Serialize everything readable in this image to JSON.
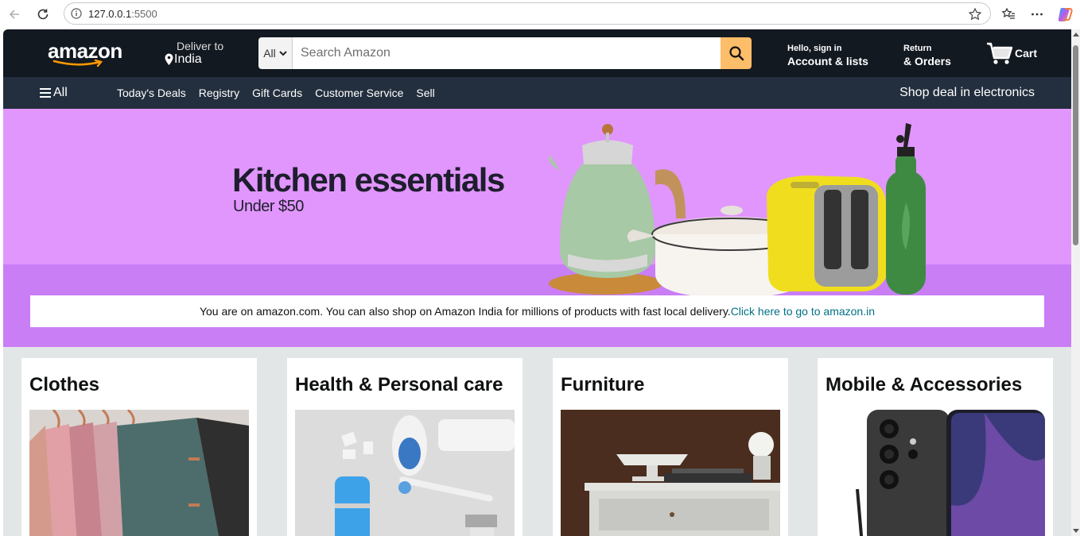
{
  "browser": {
    "url_host": "127.0.0.1",
    "url_port": ":5500"
  },
  "header": {
    "logo_text": "amazon",
    "deliver_line1": "Deliver to",
    "deliver_line2": "India",
    "search_category": "All",
    "search_placeholder": "Search Amazon",
    "account_line1": "Hello, sign in",
    "account_line2": "Account & lists",
    "returns_line1": "Return",
    "returns_line2": "& Orders",
    "cart_label": "Cart"
  },
  "subnav": {
    "all_label": "All",
    "links": [
      "Today's Deals",
      "Registry",
      "Gift Cards",
      "Customer Service",
      "Sell"
    ],
    "promo": "Shop deal in electronics"
  },
  "hero": {
    "title": "Kitchen essentials",
    "subtitle": "Under $50",
    "notice_text": "You are on amazon.com. You can also shop on Amazon India for millions of products with fast local delivery.",
    "notice_link": "Click here to go to amazon.in"
  },
  "cards": [
    {
      "title": "Clothes"
    },
    {
      "title": "Health & Personal care"
    },
    {
      "title": "Furniture"
    },
    {
      "title": "Mobile & Accessories"
    }
  ],
  "colors": {
    "header_bg": "#131921",
    "subnav_bg": "#232f3e",
    "search_button": "#febd69",
    "hero_bg": "#e196fd",
    "hero_bottom": "#c97ef6",
    "link": "#007185",
    "page_bg": "#e3e6e6"
  }
}
